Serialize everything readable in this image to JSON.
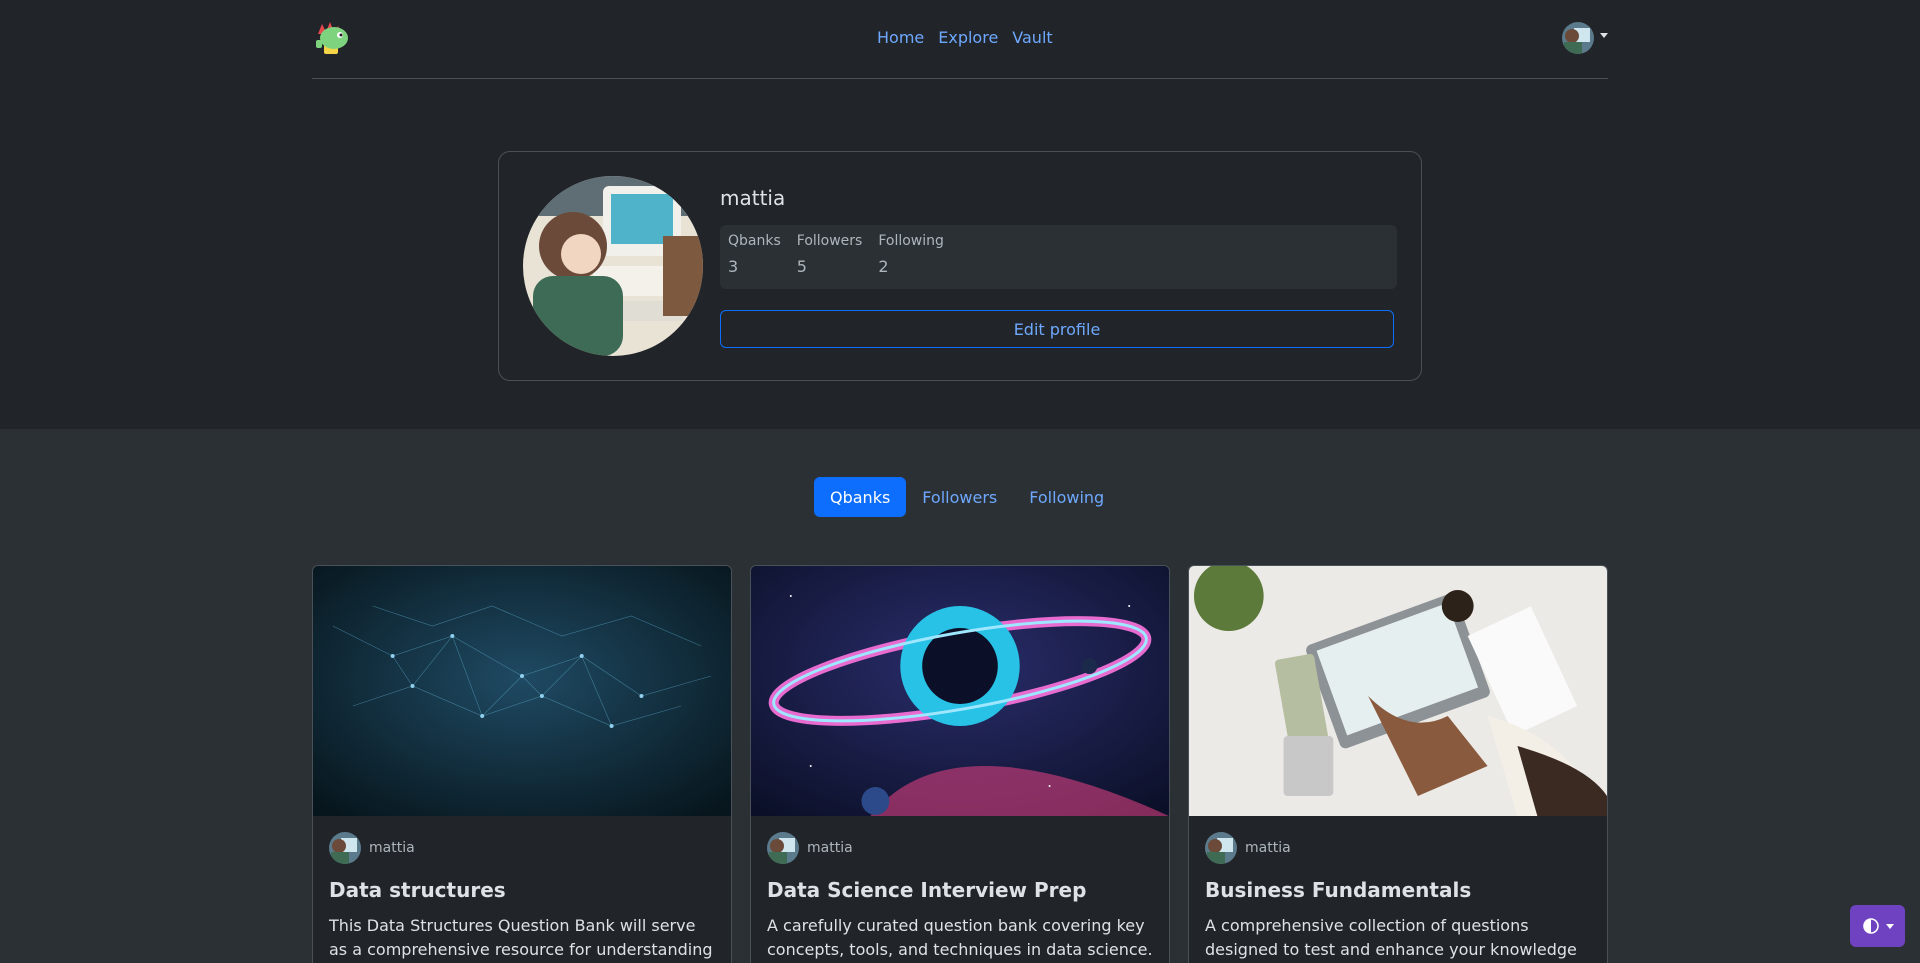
{
  "nav": {
    "links": [
      "Home",
      "Explore",
      "Vault"
    ]
  },
  "profile": {
    "username": "mattia",
    "stats": [
      {
        "label": "Qbanks",
        "value": "3"
      },
      {
        "label": "Followers",
        "value": "5"
      },
      {
        "label": "Following",
        "value": "2"
      }
    ],
    "edit_label": "Edit profile"
  },
  "tabs": [
    "Qbanks",
    "Followers",
    "Following"
  ],
  "cards": [
    {
      "author": "mattia",
      "title": "Data structures",
      "description": "This Data Structures Question Bank will serve as a comprehensive resource for understanding and"
    },
    {
      "author": "mattia",
      "title": "Data Science Interview Prep",
      "description": "A carefully curated question bank covering key concepts, tools, and techniques in data science. This"
    },
    {
      "author": "mattia",
      "title": "Business Fundamentals",
      "description": "A comprehensive collection of questions designed to test and enhance your knowledge of key business"
    }
  ],
  "colors": {
    "accent": "#0d6efd",
    "theme_button": "#6f42c1"
  }
}
